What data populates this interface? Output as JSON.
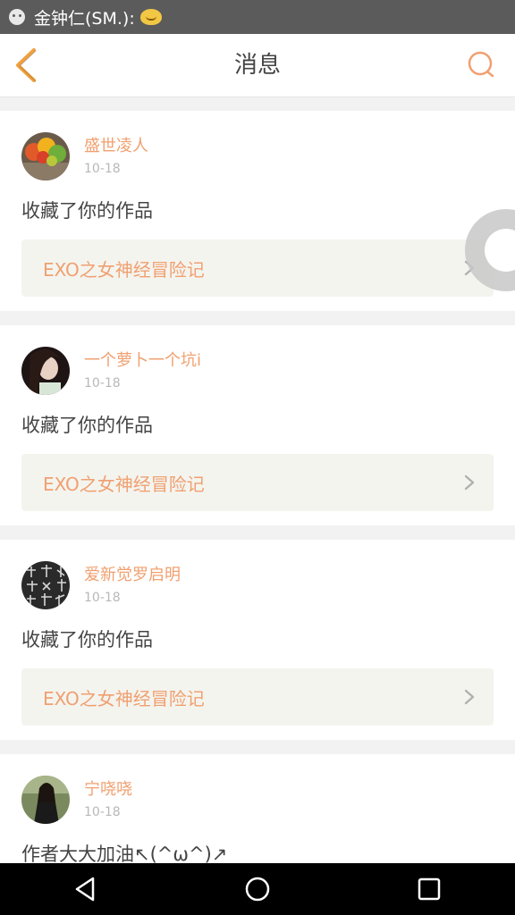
{
  "status_bar": {
    "notification_text": "金钟仁(SM.):",
    "emoji_icon": "sleepy-face-emoji"
  },
  "header": {
    "title": "消息",
    "back_icon": "chevron-left-icon",
    "search_icon": "search-icon",
    "accent_color": "#f0a070"
  },
  "messages": [
    {
      "user": "盛世凌人",
      "date": "10-18",
      "action": "收藏了你的作品",
      "work": "EXO之女神经冒险记",
      "avatar": "autumn-leaves-avatar"
    },
    {
      "user": "一个萝卜一个坑i",
      "date": "10-18",
      "action": "收藏了你的作品",
      "work": "EXO之女神经冒险记",
      "avatar": "girl-portrait-avatar"
    },
    {
      "user": "爱新觉罗启明",
      "date": "10-18",
      "action": "收藏了你的作品",
      "work": "EXO之女神经冒险记",
      "avatar": "calligraphy-pattern-avatar"
    },
    {
      "user": "宁哓哓",
      "date": "10-18",
      "action": "作者大大加油↖(^ω^)↗",
      "avatar": "woman-outdoor-avatar"
    }
  ],
  "nav_bar": {
    "back_icon": "triangle-back-icon",
    "home_icon": "circle-home-icon",
    "recents_icon": "square-recents-icon"
  }
}
